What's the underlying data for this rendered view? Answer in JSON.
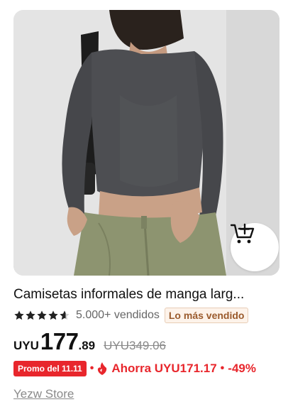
{
  "product": {
    "image_alt": "Mujer con camiseta gris de manga larga y pantalón verde",
    "title": "Camisetas informales de manga larg...",
    "rating_stars": 4.5,
    "sold_text": "5.000+ vendidos",
    "badge": "Lo más vendido",
    "price": {
      "currency": "UYU",
      "integer": "177",
      "decimal": ".89",
      "original": "UYU349.06"
    },
    "promo": {
      "badge": "Promo del 11.11",
      "separator": "•",
      "savings": "Ahorra UYU171.17",
      "discount": "-49%"
    },
    "store": "Yezw Store"
  },
  "icons": {
    "cart": "add-to-cart-icon",
    "star": "star-icon",
    "flame": "flame-icon"
  },
  "colors": {
    "promo_red": "#e8262c",
    "badge_text": "#9a5a2c",
    "badge_bg": "#fdf3ea",
    "text_muted": "#888888"
  }
}
